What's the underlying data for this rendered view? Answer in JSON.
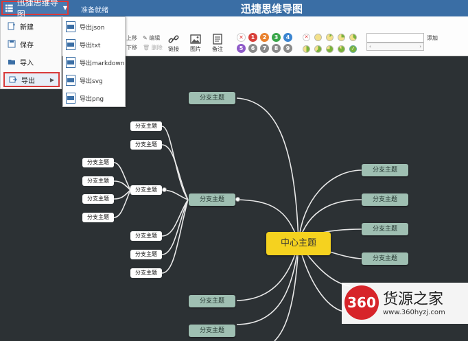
{
  "header": {
    "app_menu_label": "迅捷思维导图",
    "status": "准备就绪",
    "title": "迅捷思维导图"
  },
  "side_menu": {
    "items": [
      {
        "label": "新建",
        "icon": "new-file-icon"
      },
      {
        "label": "保存",
        "icon": "save-icon"
      },
      {
        "label": "导入",
        "icon": "folder-open-icon"
      },
      {
        "label": "导出",
        "icon": "export-icon",
        "active": true
      }
    ]
  },
  "export_menu": {
    "items": [
      {
        "label": "导出json"
      },
      {
        "label": "导出txt"
      },
      {
        "label": "导出markdown"
      },
      {
        "label": "导出svg"
      },
      {
        "label": "导出png"
      }
    ]
  },
  "toolbar": {
    "move_up": "上移",
    "move_down": "下移",
    "edit": "编辑",
    "delete": "删除",
    "link": "链接",
    "image": "图片",
    "note": "备注",
    "priorities": [
      "1",
      "2",
      "3",
      "4",
      "5",
      "6",
      "7",
      "8",
      "9"
    ],
    "add": "添加"
  },
  "mindmap": {
    "center": "中心主题",
    "branch_label": "分支主题",
    "sub_label": "分支主题"
  },
  "colors": {
    "header": "#3a6ea5",
    "canvas": "#2c3134",
    "branch": "#9fbfb2",
    "center": "#f5d21f",
    "highlight": "#d83a3a"
  },
  "watermark": {
    "logo": "360",
    "name": "货源之家",
    "url": "www.360hyzj.com"
  }
}
